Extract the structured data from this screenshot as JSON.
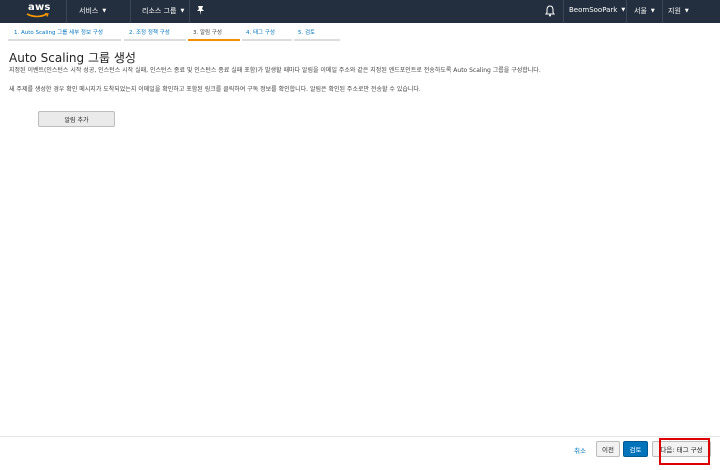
{
  "nav": {
    "logo": "aws",
    "services": "서비스",
    "resource_groups": "리소스 그룹",
    "user": "BeomSooPark",
    "region": "서울",
    "support": "지원"
  },
  "steps": [
    {
      "label": "1. Auto Scaling 그룹 세부 정보 구성",
      "active": false
    },
    {
      "label": "2. 조정 정책 구성",
      "active": false
    },
    {
      "label": "3. 알림 구성",
      "active": true
    },
    {
      "label": "4. 태그 구성",
      "active": false
    },
    {
      "label": "5. 검토",
      "active": false
    }
  ],
  "page": {
    "title": "Auto Scaling 그룹 생성",
    "description": "지정된 이벤트(인스턴스 시작 성공, 인스턴스 시작 실패, 인스턴스 종료 및 인스턴스 종료 실패 포함)가 발생할 때마다 알림을 이메일 주소와 같은 지정된 엔드포인트로 전송하도록 Auto Scaling 그룹을 구성합니다.",
    "description2": "새 주제를 생성한 경우 확인 메시지가 도착되었는지 이메일을 확인하고 포함된 링크를 클릭하여 구독 정보를 확인합니다. 알림은 확인된 주소로만 전송할 수 있습니다.",
    "add_notification": "알림 추가"
  },
  "footer": {
    "cancel": "취소",
    "previous": "이전",
    "review": "검토",
    "next": "다음: 태그 구성"
  },
  "colors": {
    "nav_bg": "#232f3e",
    "link": "#0073bb",
    "active_step": "#f29000",
    "primary_button": "#0073bb",
    "highlight": "#dd0000"
  }
}
